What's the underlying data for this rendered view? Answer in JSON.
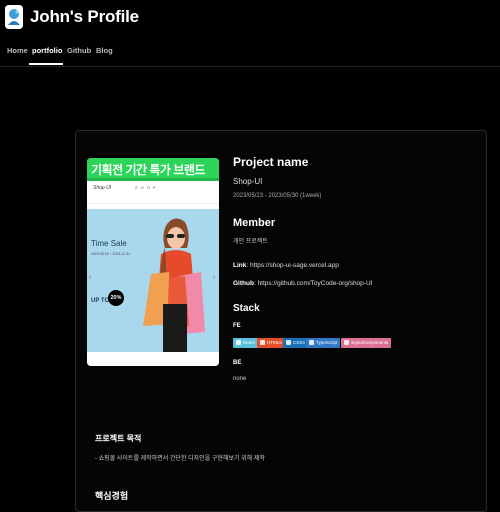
{
  "header": {
    "title": "John's Profile",
    "logo_icon": "profile-logo-icon"
  },
  "nav": {
    "items": [
      {
        "label": "Home",
        "active": false
      },
      {
        "label": "portfolio",
        "active": true
      },
      {
        "label": "Github",
        "active": false
      },
      {
        "label": "Blog",
        "active": false
      }
    ]
  },
  "project": {
    "heading": "Project name",
    "name": "Shop-UI",
    "period": "2023/05/23 - 2023/05/30 (1week)",
    "member_heading": "Member",
    "member": "개인 프로젝트",
    "link_label": "Link",
    "link_value": ": https://shop-ui-sage.vercel.app",
    "github_label": "Github",
    "github_value": ": https://github.com/ToyCode-org/shop-UI",
    "stack_heading": "Stack",
    "fe_label": "FE",
    "fe_stack": [
      {
        "label": "React",
        "color": "#5bc0de"
      },
      {
        "label": "HTML5",
        "color": "#e34f26"
      },
      {
        "label": "CSS3",
        "color": "#1572b6"
      },
      {
        "label": "TypeScript",
        "color": "#3178c6"
      },
      {
        "label": "styledComponents",
        "color": "#db7093"
      }
    ],
    "be_label": "BE",
    "be_value": "none"
  },
  "preview": {
    "banner": "기획전 기간 특가 브랜드",
    "shop_logo": "Shop UI",
    "shop_nav": "S H O P",
    "hero_title": "Time Sale",
    "hero_date": "2023.05.15 ~ 2023.12.31",
    "hero_upto": "UP TO",
    "hero_percent": "20%",
    "prev_arrow": "‹",
    "next_arrow": "›"
  },
  "purpose": {
    "heading": "프로젝트 목적",
    "text": "- 쇼핑몰 사이트를 제작하면서 간단한 디자인을 구현해보기 위해 제작"
  },
  "core": {
    "heading": "핵심경험"
  }
}
